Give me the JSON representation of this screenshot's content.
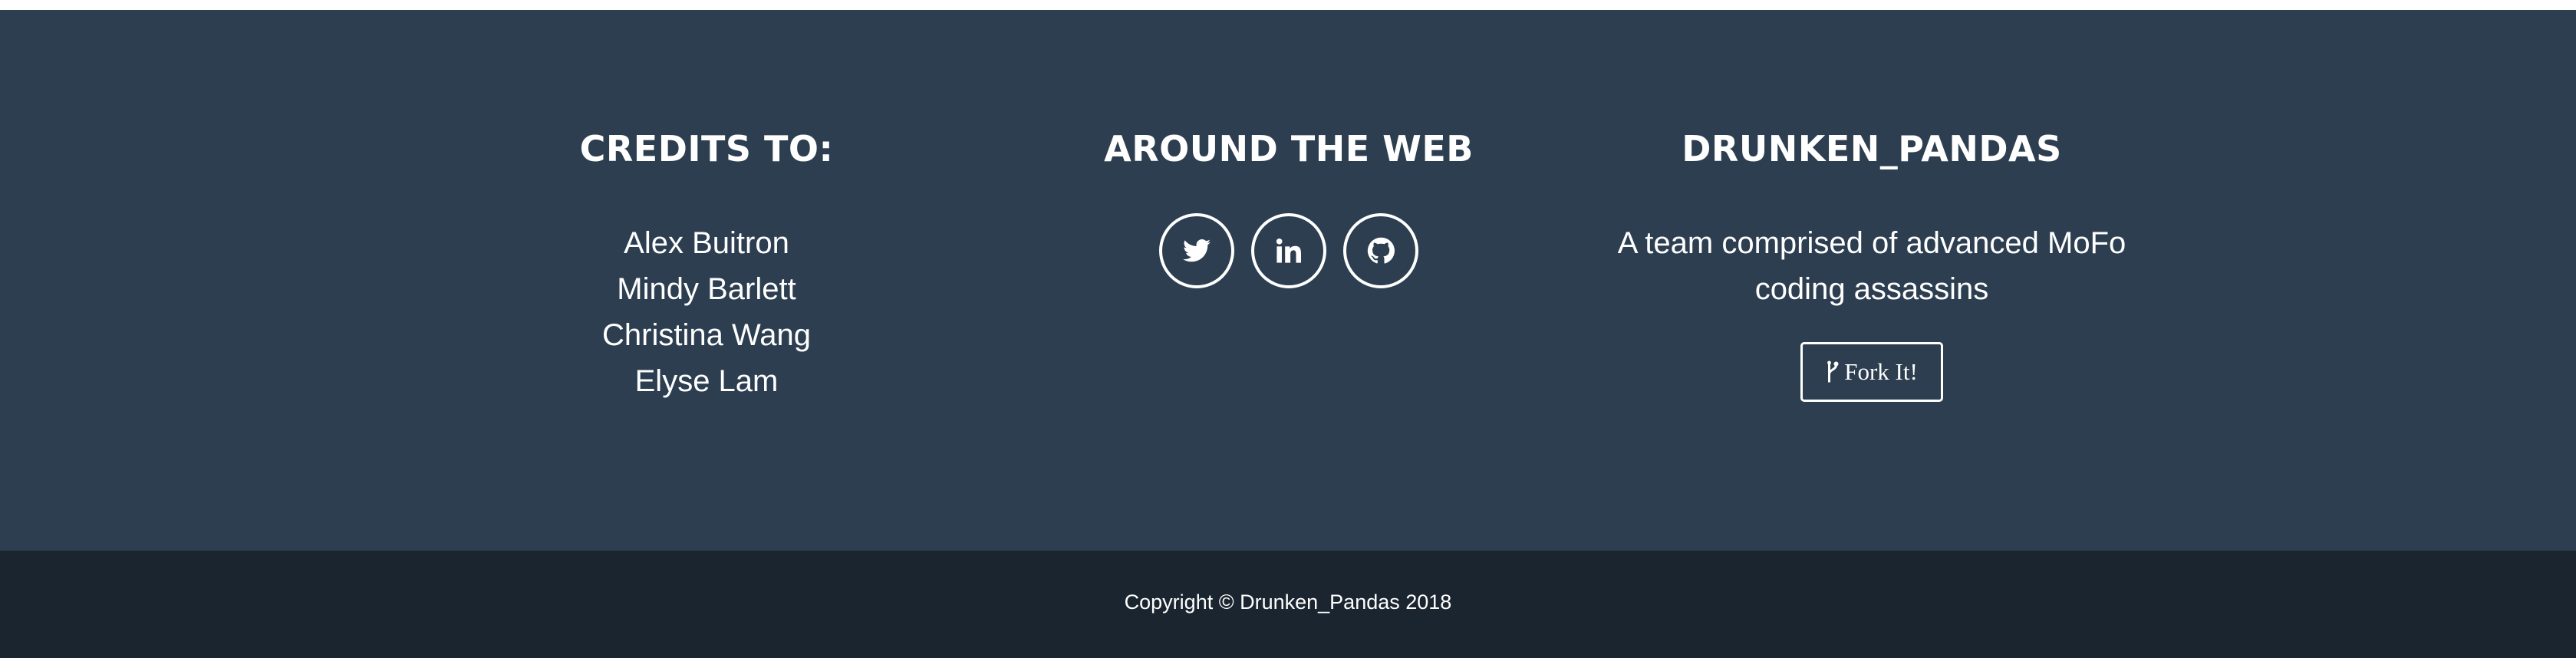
{
  "colors": {
    "footer_bg": "#2c3e50",
    "copyright_bg": "#1a252f",
    "text": "#ffffff"
  },
  "credits": {
    "heading": "CREDITS TO:",
    "names": [
      "Alex Buitron",
      "Mindy Barlett",
      "Christina Wang",
      "Elyse Lam"
    ]
  },
  "around_web": {
    "heading": "AROUND THE WEB",
    "links": [
      {
        "icon": "twitter-icon"
      },
      {
        "icon": "linkedin-icon"
      },
      {
        "icon": "github-icon"
      }
    ]
  },
  "brand": {
    "heading": "DRUNKEN_PANDAS",
    "description": "A team comprised of advanced MoFo coding assassins",
    "fork_button": {
      "icon": "git-fork-icon",
      "label": "Fork It!"
    }
  },
  "copyright": {
    "text": "Copyright © Drunken_Pandas 2018"
  }
}
